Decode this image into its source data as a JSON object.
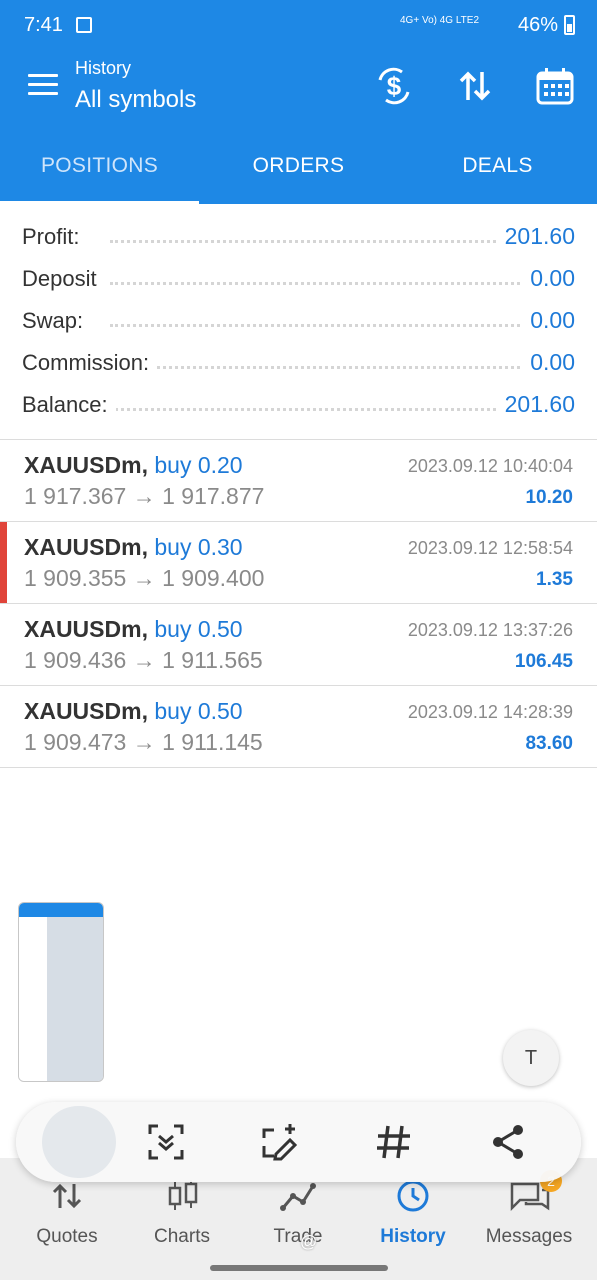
{
  "status_bar": {
    "time": "7:41",
    "network": "4G+ Vo) 4G LTE2",
    "battery": "46%"
  },
  "app_bar": {
    "title": "History",
    "subtitle": "All symbols"
  },
  "tabs": [
    {
      "label": "POSITIONS",
      "active": true
    },
    {
      "label": "ORDERS",
      "active": false
    },
    {
      "label": "DEALS",
      "active": false
    }
  ],
  "summary": [
    {
      "label": "Profit:",
      "value": "201.60"
    },
    {
      "label": "Deposit",
      "value": "0.00"
    },
    {
      "label": "Swap:",
      "value": "0.00"
    },
    {
      "label": "Commission:",
      "value": "0.00"
    },
    {
      "label": "Balance:",
      "value": "201.60"
    }
  ],
  "deals": [
    {
      "symbol": "XAUUSDm,",
      "side": "buy 0.20",
      "open": "1 917.367",
      "arrow": "→",
      "close": "1 917.877",
      "datetime": "2023.09.12 10:40:04",
      "profit": "10.20",
      "marked": false
    },
    {
      "symbol": "XAUUSDm,",
      "side": "buy 0.30",
      "open": "1 909.355",
      "arrow": "→",
      "close": "1 909.400",
      "datetime": "2023.09.12 12:58:54",
      "profit": "1.35",
      "marked": true
    },
    {
      "symbol": "XAUUSDm,",
      "side": "buy 0.50",
      "open": "1 909.436",
      "arrow": "→",
      "close": "1 911.565",
      "datetime": "2023.09.12 13:37:26",
      "profit": "106.45",
      "marked": false
    },
    {
      "symbol": "XAUUSDm,",
      "side": "buy 0.50",
      "open": "1 909.473",
      "arrow": "→",
      "close": "1 911.145",
      "datetime": "2023.09.12 14:28:39",
      "profit": "83.60",
      "marked": false
    }
  ],
  "bottom_nav": [
    {
      "label": "Quotes",
      "icon": "quotes-icon"
    },
    {
      "label": "Charts",
      "icon": "charts-icon"
    },
    {
      "label": "Trade",
      "icon": "trade-icon"
    },
    {
      "label": "History",
      "icon": "history-icon",
      "active": true
    },
    {
      "label": "Messages",
      "icon": "messages-icon",
      "badge": "2"
    }
  ],
  "text_button": {
    "glyph": "T"
  },
  "watermark": "@"
}
